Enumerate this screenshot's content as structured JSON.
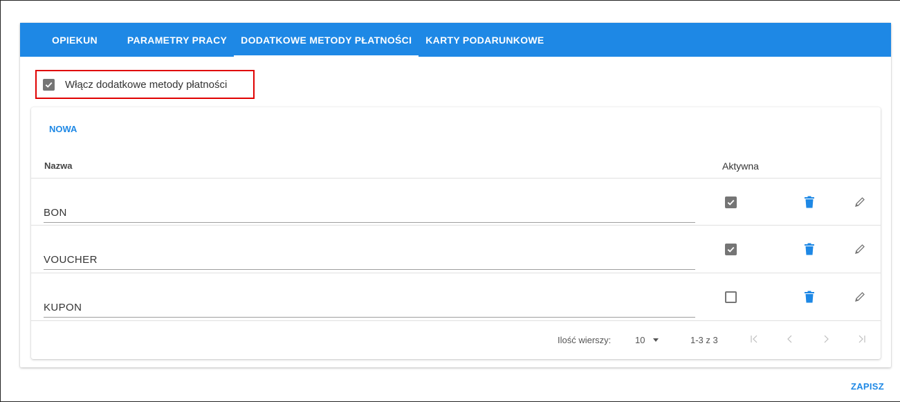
{
  "tabs": [
    {
      "label": "OPIEKUN"
    },
    {
      "label": "PARAMETRY PRACY"
    },
    {
      "label": "DODATKOWE METODY PŁATNOŚCI"
    },
    {
      "label": "KARTY PODARUNKOWE"
    }
  ],
  "active_tab": "DODATKOWE METODY PŁATNOŚCI",
  "enable_option": {
    "label": "Włącz dodatkowe metody płatności",
    "checked": true
  },
  "table": {
    "new_button": "NOWA",
    "headers": {
      "name": "Nazwa",
      "active": "Aktywna"
    },
    "rows": [
      {
        "name": "BON",
        "active": true
      },
      {
        "name": "VOUCHER",
        "active": true
      },
      {
        "name": "KUPON",
        "active": false
      }
    ],
    "footer": {
      "rows_per_page_label": "Ilość wierszy:",
      "rows_per_page_value": "10",
      "range_text": "1-3 z 3"
    }
  },
  "save_button": "ZAPISZ",
  "colors": {
    "primary": "#1e88e5",
    "checkbox": "#757575",
    "highlight_border": "#e00000"
  },
  "icons": {
    "delete": "trash-icon",
    "edit": "pencil-icon"
  }
}
